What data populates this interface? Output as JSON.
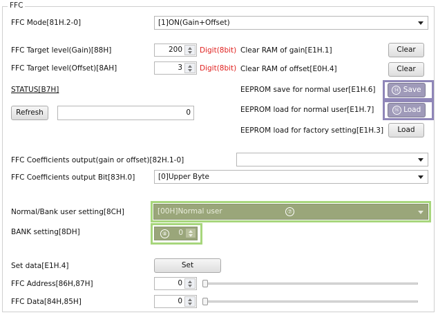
{
  "group_title": "FFC",
  "mode": {
    "label": "FFC Mode[81H.2-0]",
    "value": "[1]ON(Gain+Offset)"
  },
  "target_gain": {
    "label": "FFC Target level(Gain)[88H]",
    "value": "200",
    "digit": "Digit(8bit)"
  },
  "target_offset": {
    "label": "FFC Target level(Offset)[8AH]",
    "value": "3",
    "digit": "Digit(8bit)"
  },
  "clear_gain": {
    "label": "Clear RAM of gain[E1H.1]",
    "button": "Clear"
  },
  "clear_offset": {
    "label": "Clear RAM of offset[E0H.4]",
    "button": "Clear"
  },
  "status": {
    "label": "STATUS[B7H]",
    "refresh": "Refresh",
    "value": "0"
  },
  "eeprom_save_user": {
    "label": "EEPROM save for normal user[E1H.6]",
    "button": "Save",
    "marker": "⑭"
  },
  "eeprom_load_user": {
    "label": "EEPROM load for normal user[E1H.7]",
    "button": "Load",
    "marker": "⑮"
  },
  "eeprom_load_factory": {
    "label": "EEPROM load for factory setting[E1H.3]",
    "button": "Load"
  },
  "coef_output": {
    "label": "FFC Coefficients output(gain or offset)[82H.1-0]",
    "value": ""
  },
  "coef_bit": {
    "label": "FFC Coefficients output Bit[83H.0]",
    "value": "[0]Upper Byte"
  },
  "bank_user": {
    "label": "Normal/Bank user setting[8CH]",
    "value": "[00H]Normal user",
    "marker": "⑦"
  },
  "bank_setting": {
    "label": "BANK setting[8DH]",
    "value": "0",
    "marker": "⑧"
  },
  "set_data": {
    "label": "Set data[E1H.4]",
    "button": "Set"
  },
  "ffc_address": {
    "label": "FFC Address[86H,87H]",
    "value": "0",
    "slider_level": 0
  },
  "ffc_data": {
    "label": "FFC Data[84H,85H]",
    "value": "0",
    "slider_level": 0
  },
  "colors": {
    "digit": "#e0201e",
    "highlight_purple": "#8f86b8",
    "highlight_green": "#a7d67c",
    "disabled_fill": "#9aa67a"
  }
}
